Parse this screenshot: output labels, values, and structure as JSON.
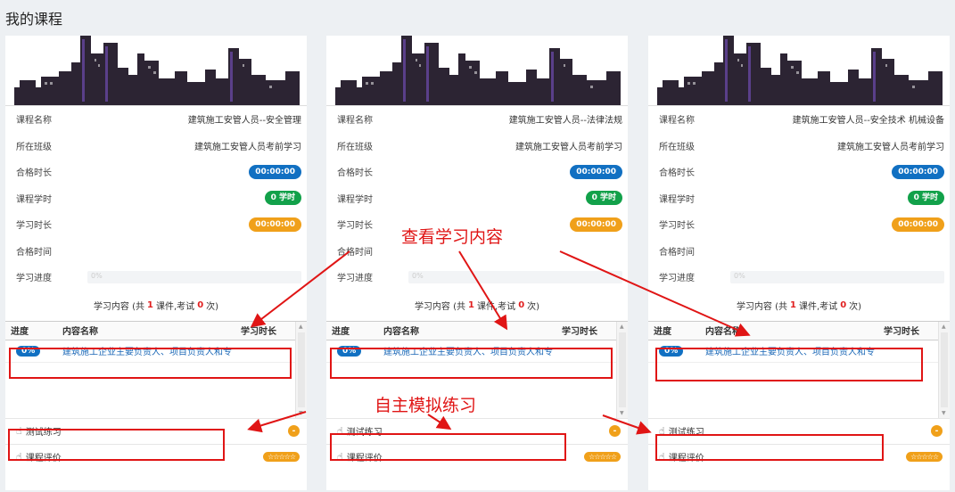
{
  "page_title": "我的课程",
  "cards": [
    {
      "course_name_label": "课程名称",
      "course_name": "建筑施工安管人员--安全管理",
      "class_label": "所在班级",
      "class_name": "建筑施工安管人员考前学习",
      "pass_time_label": "合格时长",
      "pass_time": "00:00:00",
      "hours_label": "课程学时",
      "hours": "0 学时",
      "study_time_label": "学习时长",
      "study_time": "00:00:00",
      "pass_date_label": "合格时间",
      "pass_date": "",
      "progress_label": "学习进度",
      "progress_text": "0%",
      "summary_prefix": "学习内容 (共",
      "summary_courses": "1",
      "summary_mid": "课件,考试",
      "summary_exams": "0",
      "summary_suffix": "次)",
      "col_progress": "进度",
      "col_name": "内容名称",
      "col_time": "学习时长",
      "item_progress": "0%",
      "item_name": "建筑施工企业主要负责人、项目负责人和专",
      "practice_label": "测试练习",
      "practice_badge": "-",
      "review_label": "课程评价",
      "review_stars": "☆☆☆☆☆"
    },
    {
      "course_name_label": "课程名称",
      "course_name": "建筑施工安管人员--法律法规",
      "class_label": "所在班级",
      "class_name": "建筑施工安管人员考前学习",
      "pass_time_label": "合格时长",
      "pass_time": "00:00:00",
      "hours_label": "课程学时",
      "hours": "0 学时",
      "study_time_label": "学习时长",
      "study_time": "00:00:00",
      "pass_date_label": "合格时间",
      "pass_date": "",
      "progress_label": "学习进度",
      "progress_text": "0%",
      "summary_prefix": "学习内容 (共",
      "summary_courses": "1",
      "summary_mid": "课件,考试",
      "summary_exams": "0",
      "summary_suffix": "次)",
      "col_progress": "进度",
      "col_name": "内容名称",
      "col_time": "学习时长",
      "item_progress": "0%",
      "item_name": "建筑施工企业主要负责人、项目负责人和专",
      "practice_label": "测试练习",
      "practice_badge": "-",
      "review_label": "课程评价",
      "review_stars": "☆☆☆☆☆"
    },
    {
      "course_name_label": "课程名称",
      "course_name": "建筑施工安管人员--安全技术 机械设备",
      "class_label": "所在班级",
      "class_name": "建筑施工安管人员考前学习",
      "pass_time_label": "合格时长",
      "pass_time": "00:00:00",
      "hours_label": "课程学时",
      "hours": "0 学时",
      "study_time_label": "学习时长",
      "study_time": "00:00:00",
      "pass_date_label": "合格时间",
      "pass_date": "",
      "progress_label": "学习进度",
      "progress_text": "0%",
      "summary_prefix": "学习内容 (共",
      "summary_courses": "1",
      "summary_mid": "课件,考试",
      "summary_exams": "0",
      "summary_suffix": "次)",
      "col_progress": "进度",
      "col_name": "内容名称",
      "col_time": "学习时长",
      "item_progress": "0%",
      "item_name": "建筑施工企业主要负责人、项目负责人和专",
      "practice_label": "测试练习",
      "practice_badge": "-",
      "review_label": "课程评价",
      "review_stars": "☆☆☆☆☆"
    }
  ],
  "annotations": {
    "view_content": "查看学习内容",
    "self_practice": "自主模拟练习"
  },
  "colors": {
    "accent_blue": "#1170c2",
    "green": "#12a14a",
    "orange": "#f0a01a",
    "annotation_red": "#e01515"
  }
}
